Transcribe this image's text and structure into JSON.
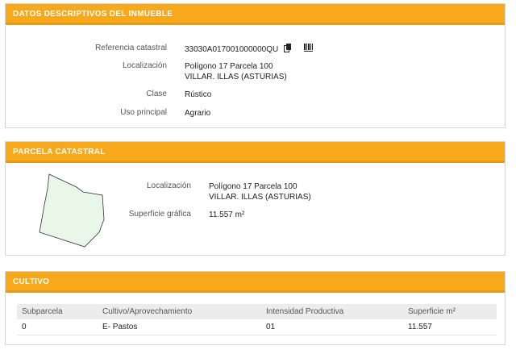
{
  "datos": {
    "header": "DATOS DESCRIPTIVOS DEL INMUEBLE",
    "ref_label": "Referencia catastral",
    "ref_value": "33030A017001000000QU",
    "loc_label": "Localización",
    "loc_line1": "Polígono 17 Parcela 100",
    "loc_line2": "VILLAR. ILLAS (ASTURIAS)",
    "clase_label": "Clase",
    "clase_value": "Rústico",
    "uso_label": "Uso principal",
    "uso_value": "Agrario"
  },
  "parcela": {
    "header": "PARCELA CATASTRAL",
    "loc_label": "Localización",
    "loc_line1": "Polígono 17 Parcela 100",
    "loc_line2": "VILLAR. ILLAS (ASTURIAS)",
    "sup_label": "Superficie gráfica",
    "sup_value": "11.557 m²"
  },
  "cultivo": {
    "header": "CULTIVO",
    "columns": [
      "Subparcela",
      "Cultivo/Aprovechamiento",
      "Intensidad Productiva",
      "Superficie m²"
    ],
    "rows": [
      [
        "0",
        "E- Pastos",
        "01",
        "11.557"
      ]
    ]
  },
  "colors": {
    "accent": "#f7a81b",
    "parcel_fill": "#e8f7e8"
  }
}
